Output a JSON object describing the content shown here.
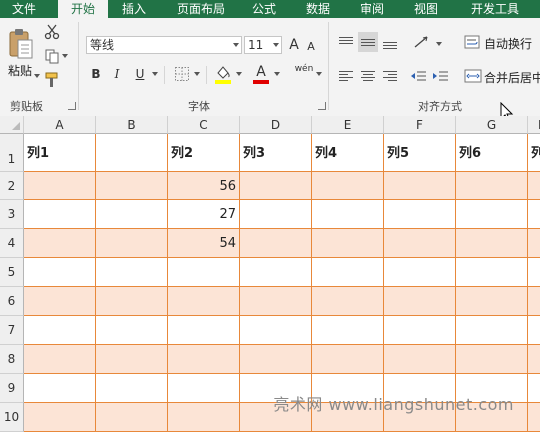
{
  "tabs": [
    "文件",
    "开始",
    "插入",
    "页面布局",
    "公式",
    "数据",
    "审阅",
    "视图",
    "开发工具"
  ],
  "clipboard": {
    "paste_label": "粘贴",
    "group_label": "剪贴板"
  },
  "font": {
    "name": "等线",
    "size": "11",
    "group_label": "字体",
    "bold": "B",
    "italic": "I",
    "underline": "U",
    "font_color_letter": "A",
    "phonetic_label": "wén",
    "grow": "A",
    "shrink": "A"
  },
  "alignment": {
    "wrap_text": "自动换行",
    "merge_center": "合并后居中",
    "group_label": "对齐方式"
  },
  "columns": [
    "A",
    "B",
    "C",
    "D",
    "E",
    "F",
    "G",
    "H"
  ],
  "rows": [
    "1",
    "2",
    "3",
    "4",
    "5",
    "6",
    "7",
    "8",
    "9",
    "10"
  ],
  "header_row": [
    "列1",
    "",
    "列2",
    "列3",
    "列4",
    "列5",
    "列6",
    "列"
  ],
  "c_values": [
    "56",
    "27",
    "54"
  ],
  "watermark": "亮术网 www.liangshunet.com",
  "colors": {
    "accent": "#217346",
    "band": "#fce4d6",
    "border": "#e8883a"
  }
}
